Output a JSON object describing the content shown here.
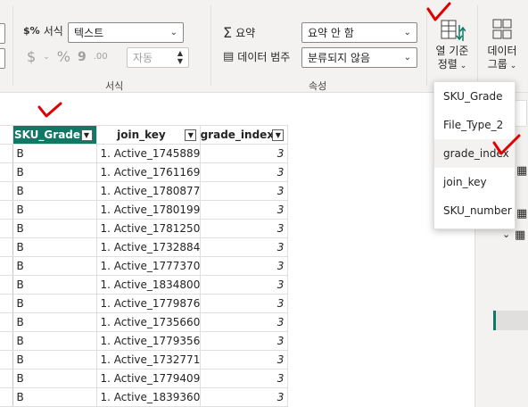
{
  "ribbon": {
    "format_group": {
      "label": "서식",
      "format_caption": "서식",
      "format_value": "텍스트",
      "decimal_value": "자동",
      "currency_symbol": "$",
      "percent_symbol": "%",
      "comma_symbol": "9",
      "decimals_symbol": ".00"
    },
    "properties_group": {
      "label": "속성",
      "summarize_label": "요약",
      "summarize_value": "요약 안 함",
      "category_label": "데이터 범주",
      "category_value": "분류되지 않음"
    },
    "sort_by_column": {
      "line1": "열 기준",
      "line2": "정렬"
    },
    "data_groups": {
      "line1": "데이터",
      "line2": "그룹"
    }
  },
  "menu": {
    "items": [
      "SKU_Grade",
      "File_Type_2",
      "grade_index",
      "join_key",
      "SKU_number"
    ]
  },
  "table": {
    "columns": [
      "SKU_Grade",
      "join_key",
      "grade_index"
    ],
    "rows": [
      [
        "B",
        "1. Active_1745889",
        "3"
      ],
      [
        "B",
        "1. Active_1761169",
        "3"
      ],
      [
        "B",
        "1. Active_1780877",
        "3"
      ],
      [
        "B",
        "1. Active_1780199",
        "3"
      ],
      [
        "B",
        "1. Active_1781250",
        "3"
      ],
      [
        "B",
        "1. Active_1732884",
        "3"
      ],
      [
        "B",
        "1. Active_1777370",
        "3"
      ],
      [
        "B",
        "1. Active_1834800",
        "3"
      ],
      [
        "B",
        "1. Active_1779876",
        "3"
      ],
      [
        "B",
        "1. Active_1735660",
        "3"
      ],
      [
        "B",
        "1. Active_1779356",
        "3"
      ],
      [
        "B",
        "1. Active_1732771",
        "3"
      ],
      [
        "B",
        "1. Active_1779409",
        "3"
      ],
      [
        "B",
        "1. Active_1839360",
        "3"
      ]
    ]
  },
  "colors": {
    "accent": "#117865",
    "annotation": "#e00000"
  }
}
